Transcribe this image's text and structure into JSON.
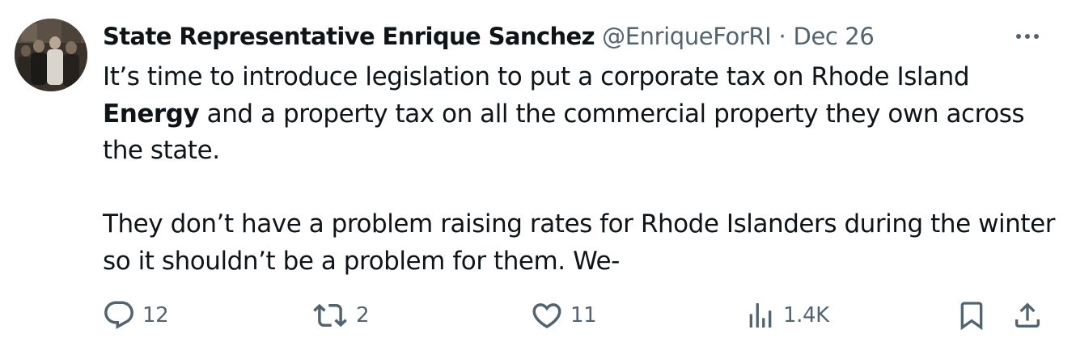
{
  "tweet": {
    "author_name": "State Representative Enrique Sanchez",
    "author_handle": "@EnriqueForRI",
    "separator": "·",
    "date": "Dec 26",
    "text": {
      "p1_a": "It’s time to introduce legislation to put a corporate tax on Rhode Island ",
      "p1_bold": "Energy",
      "p1_b": " and a property tax on all the commercial property they own across the state.",
      "p2": "They don’t have a problem raising rates for Rhode Islanders during the winter so it shouldn’t be a problem for them. We-"
    }
  },
  "actions": {
    "replies": "12",
    "reposts": "2",
    "likes": "11",
    "views": "1.4K"
  },
  "icons": {
    "avatar": "avatar-photo",
    "more": "more-icon",
    "reply": "reply-icon",
    "repost": "repost-icon",
    "like": "heart-icon",
    "views": "views-icon",
    "bookmark": "bookmark-icon",
    "share": "share-icon"
  },
  "colors": {
    "text": "#0f1419",
    "secondary": "#536471",
    "background": "#ffffff"
  }
}
